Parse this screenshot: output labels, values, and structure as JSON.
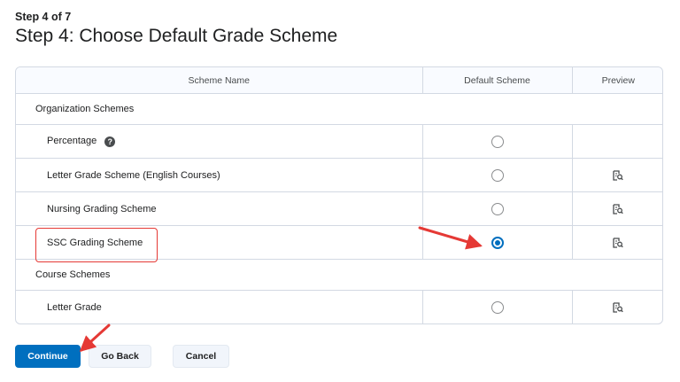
{
  "header": {
    "step_kicker": "Step 4 of 7",
    "title": "Step 4: Choose Default Grade Scheme"
  },
  "table": {
    "columns": [
      "Scheme Name",
      "Default Scheme",
      "Preview"
    ],
    "sections": [
      {
        "label": "Organization Schemes",
        "rows": [
          {
            "name": "Percentage",
            "has_help": true,
            "selected": false,
            "has_preview": false
          },
          {
            "name": "Letter Grade Scheme (English Courses)",
            "has_help": false,
            "selected": false,
            "has_preview": true
          },
          {
            "name": "Nursing Grading Scheme",
            "has_help": false,
            "selected": false,
            "has_preview": true
          },
          {
            "name": "SSC Grading Scheme",
            "has_help": false,
            "selected": true,
            "has_preview": true
          }
        ]
      },
      {
        "label": "Course Schemes",
        "rows": [
          {
            "name": "Letter Grade",
            "has_help": false,
            "selected": false,
            "has_preview": true
          }
        ]
      }
    ]
  },
  "buttons": {
    "continue": "Continue",
    "go_back": "Go Back",
    "cancel": "Cancel"
  },
  "icons": {
    "help": "question-circle-icon",
    "preview": "preview-document-search-icon"
  },
  "colors": {
    "primary": "#006fbf",
    "annotation": "#e53935"
  }
}
